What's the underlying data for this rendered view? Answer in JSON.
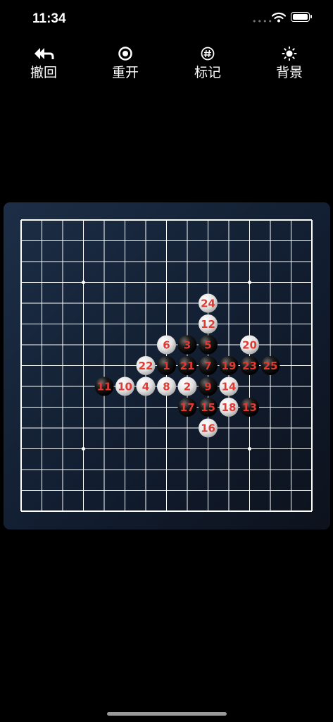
{
  "status": {
    "time": "11:34"
  },
  "toolbar": {
    "undo": {
      "label": "撤回",
      "icon": "undo-arrow-icon"
    },
    "restart": {
      "label": "重开",
      "icon": "restart-ring-icon"
    },
    "mark": {
      "label": "标记",
      "icon": "hash-mark-icon"
    },
    "background": {
      "label": "背景",
      "icon": "sun-icon"
    }
  },
  "board": {
    "size": 15,
    "star_points": [
      [
        3,
        3
      ],
      [
        11,
        3
      ],
      [
        3,
        11
      ],
      [
        11,
        11
      ]
    ],
    "number_color": "#e23a32",
    "black_color": "#111111",
    "white_color": "#e6e6e6",
    "stones": [
      {
        "n": 1,
        "color": "black",
        "col": 7,
        "row": 7
      },
      {
        "n": 2,
        "color": "white",
        "col": 8,
        "row": 8
      },
      {
        "n": 3,
        "color": "black",
        "col": 8,
        "row": 6
      },
      {
        "n": 4,
        "color": "white",
        "col": 6,
        "row": 8
      },
      {
        "n": 5,
        "color": "black",
        "col": 9,
        "row": 6
      },
      {
        "n": 6,
        "color": "white",
        "col": 7,
        "row": 6
      },
      {
        "n": 7,
        "color": "black",
        "col": 9,
        "row": 7
      },
      {
        "n": 8,
        "color": "white",
        "col": 7,
        "row": 8
      },
      {
        "n": 9,
        "color": "black",
        "col": 9,
        "row": 8
      },
      {
        "n": 10,
        "color": "white",
        "col": 5,
        "row": 8
      },
      {
        "n": 11,
        "color": "black",
        "col": 4,
        "row": 8
      },
      {
        "n": 12,
        "color": "white",
        "col": 9,
        "row": 5
      },
      {
        "n": 13,
        "color": "black",
        "col": 11,
        "row": 9
      },
      {
        "n": 14,
        "color": "white",
        "col": 10,
        "row": 8
      },
      {
        "n": 15,
        "color": "black",
        "col": 9,
        "row": 9
      },
      {
        "n": 16,
        "color": "white",
        "col": 9,
        "row": 10
      },
      {
        "n": 17,
        "color": "black",
        "col": 8,
        "row": 9
      },
      {
        "n": 18,
        "color": "white",
        "col": 10,
        "row": 9
      },
      {
        "n": 19,
        "color": "black",
        "col": 10,
        "row": 7
      },
      {
        "n": 20,
        "color": "white",
        "col": 11,
        "row": 6
      },
      {
        "n": 21,
        "color": "black",
        "col": 8,
        "row": 7
      },
      {
        "n": 22,
        "color": "white",
        "col": 6,
        "row": 7
      },
      {
        "n": 23,
        "color": "black",
        "col": 11,
        "row": 7
      },
      {
        "n": 24,
        "color": "white",
        "col": 9,
        "row": 4
      },
      {
        "n": 25,
        "color": "black",
        "col": 12,
        "row": 7
      }
    ]
  }
}
